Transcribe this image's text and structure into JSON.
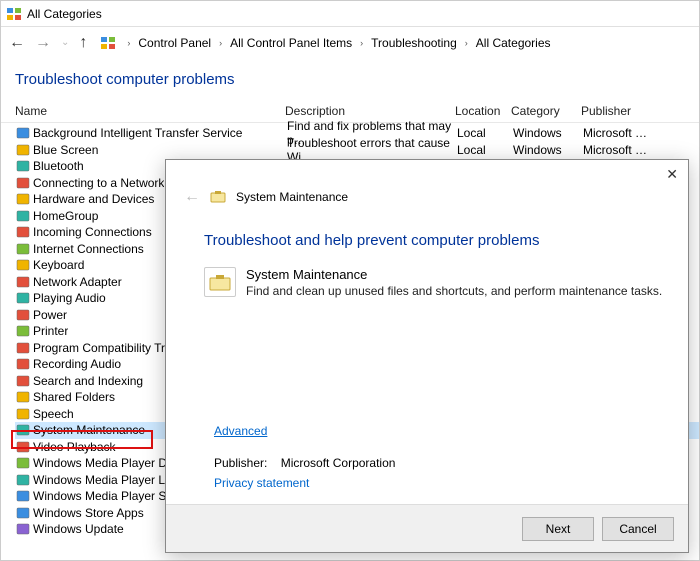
{
  "window": {
    "title": "All Categories"
  },
  "breadcrumb": {
    "segs": [
      "Control Panel",
      "All Control Panel Items",
      "Troubleshooting",
      "All Categories"
    ]
  },
  "page": {
    "title": "Troubleshoot computer problems"
  },
  "columns": {
    "name": "Name",
    "desc": "Description",
    "loc": "Location",
    "cat": "Category",
    "pub": "Publisher"
  },
  "rows_full": [
    {
      "label": "Background Intelligent Transfer Service",
      "desc": "Find and fix problems that may p…",
      "loc": "Local",
      "cat": "Windows",
      "pub": "Microsoft …"
    },
    {
      "label": "Blue Screen",
      "desc": "Troubleshoot errors that cause Wi…",
      "loc": "Local",
      "cat": "Windows",
      "pub": "Microsoft …"
    }
  ],
  "rows_rest": [
    "Bluetooth",
    "Connecting to a Network",
    "Hardware and Devices",
    "HomeGroup",
    "Incoming Connections",
    "Internet Connections",
    "Keyboard",
    "Network Adapter",
    "Playing Audio",
    "Power",
    "Printer",
    "Program Compatibility Troubleshooter",
    "Recording Audio",
    "Search and Indexing",
    "Shared Folders",
    "Speech",
    "System Maintenance",
    "Video Playback",
    "Windows Media Player DVD",
    "Windows Media Player Library",
    "Windows Media Player Settings",
    "Windows Store Apps",
    "Windows Update"
  ],
  "selected_index": 16,
  "dialog": {
    "titlebar": "System Maintenance",
    "heading": "Troubleshoot and help prevent computer problems",
    "item_title": "System Maintenance",
    "item_sub": "Find and clean up unused files and shortcuts, and perform maintenance tasks.",
    "advanced": "Advanced",
    "publisher_label": "Publisher:",
    "publisher_value": "Microsoft Corporation",
    "privacy": "Privacy statement",
    "next": "Next",
    "cancel": "Cancel"
  }
}
